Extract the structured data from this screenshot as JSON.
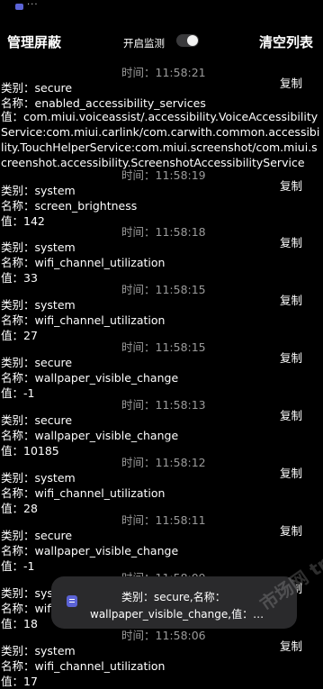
{
  "status": {
    "dots": "···"
  },
  "header": {
    "left_title": "管理屏蔽",
    "monitor_label": "开启监测",
    "monitor_on": true,
    "right_title": "清空列表"
  },
  "labels": {
    "category": "类别：",
    "name": "名称：",
    "value": "值：",
    "time": "时间：",
    "copy": "复制"
  },
  "entries": [
    {
      "time": "11:58:21",
      "category": "secure",
      "name": "enabled_accessibility_services",
      "value": "com.miui.voiceassist/.accessibility.VoiceAccessibilityService:com.miui.carlink/com.carwith.common.accessibility.TouchHelperService:com.miui.screenshot/com.miui.screenshot.accessibility.ScreenshotAccessibilityService"
    },
    {
      "time": "11:58:19",
      "category": "system",
      "name": "screen_brightness",
      "value": "142"
    },
    {
      "time": "11:58:18",
      "category": "system",
      "name": "wifi_channel_utilization",
      "value": "33"
    },
    {
      "time": "11:58:15",
      "category": "system",
      "name": "wifi_channel_utilization",
      "value": "27"
    },
    {
      "time": "11:58:15",
      "category": "secure",
      "name": "wallpaper_visible_change",
      "value": "-1"
    },
    {
      "time": "11:58:13",
      "category": "secure",
      "name": "wallpaper_visible_change",
      "value": "10185"
    },
    {
      "time": "11:58:12",
      "category": "system",
      "name": "wifi_channel_utilization",
      "value": "28"
    },
    {
      "time": "11:58:11",
      "category": "secure",
      "name": "wallpaper_visible_change",
      "value": "-1"
    },
    {
      "time": "11:58:09",
      "category": "system",
      "name": "wifi_channel_utilization",
      "value": "18"
    },
    {
      "time": "11:58:06",
      "category": "system",
      "name": "wifi_channel_utilization",
      "value": "17"
    }
  ],
  "toast": {
    "line1": "类别：secure,名称：",
    "line2": "wallpaper_visible_change,值：…"
  },
  "watermark": "市场网 trunz.com"
}
